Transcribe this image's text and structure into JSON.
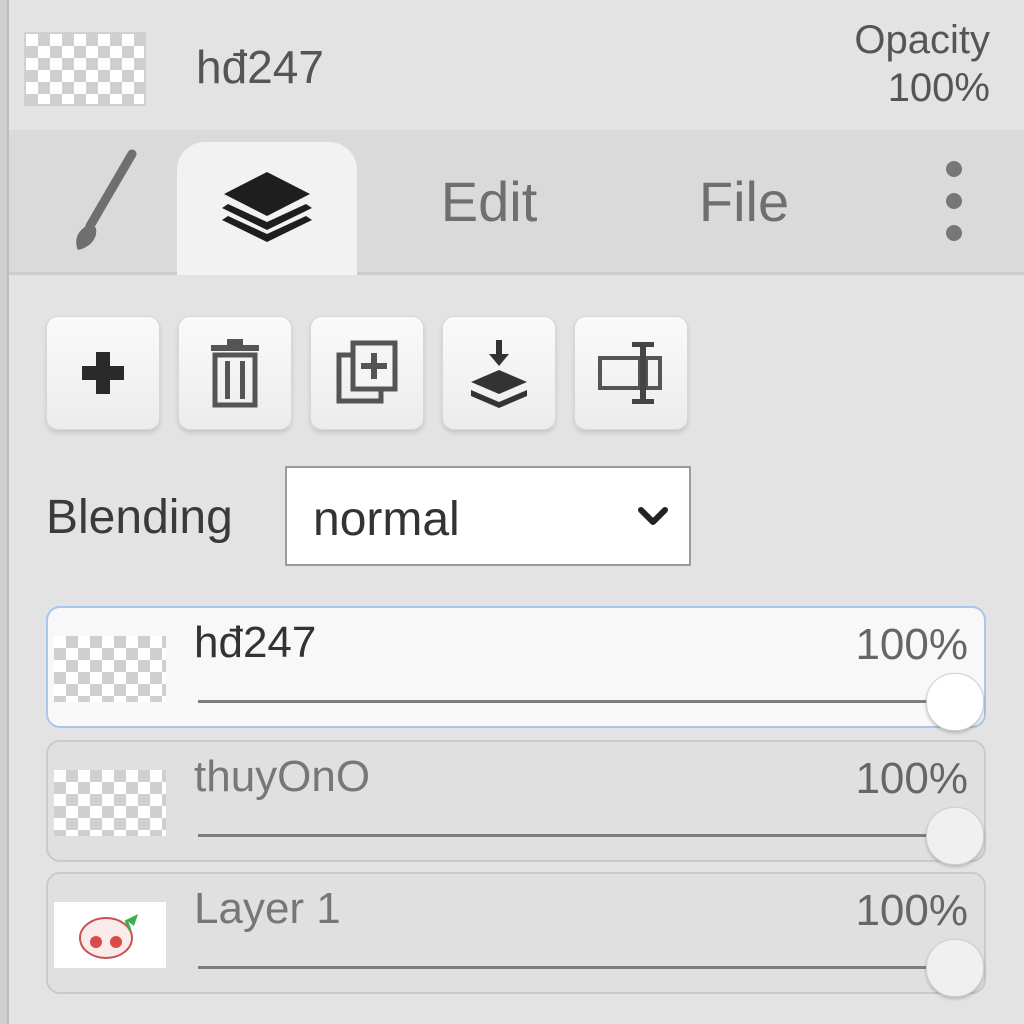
{
  "header": {
    "layer_name": "hđ247",
    "opacity_label": "Opacity",
    "opacity_value": "100%"
  },
  "tabs": [
    {
      "label": "",
      "icon": "brush-icon"
    },
    {
      "label": "",
      "icon": "layers-icon",
      "active": true
    },
    {
      "label": "Edit"
    },
    {
      "label": "File"
    },
    {
      "label": "",
      "icon": "more-vertical-icon"
    }
  ],
  "toolbar": {
    "buttons": [
      {
        "icon": "plus-icon"
      },
      {
        "icon": "trash-icon"
      },
      {
        "icon": "duplicate-layer-icon"
      },
      {
        "icon": "merge-down-icon"
      },
      {
        "icon": "rename-icon"
      }
    ]
  },
  "blending": {
    "label": "Blending",
    "value": "normal"
  },
  "layers": [
    {
      "name": "hđ247",
      "opacity": "100%",
      "opacity_fraction": 1.0,
      "selected": true
    },
    {
      "name": "thuyOnO",
      "opacity": "100%",
      "opacity_fraction": 1.0,
      "selected": false
    },
    {
      "name": "Layer 1",
      "opacity": "100%",
      "opacity_fraction": 1.0,
      "selected": false
    }
  ],
  "colors": {
    "background": "#e3e3e3",
    "selected_border": "#a9c6ee",
    "active_tab": "#f2f2f2"
  }
}
